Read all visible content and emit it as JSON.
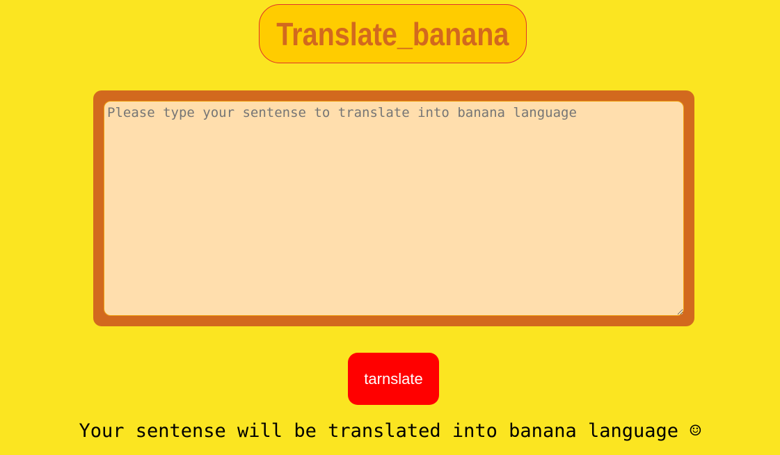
{
  "header": {
    "title": "Translate_banana"
  },
  "input": {
    "value": "",
    "placeholder": "Please type your sentense to translate into banana language"
  },
  "actions": {
    "translate_label": "tarnslate"
  },
  "output": {
    "text": "Your sentense will be translated into banana language ☺"
  },
  "colors": {
    "page_background": "#fbe521",
    "title_background": "#ffcc00",
    "title_text": "#d2691e",
    "card_background": "#d2691e",
    "textarea_background": "#ffdead",
    "button_background": "#ff0000",
    "button_text": "#ffffff"
  }
}
